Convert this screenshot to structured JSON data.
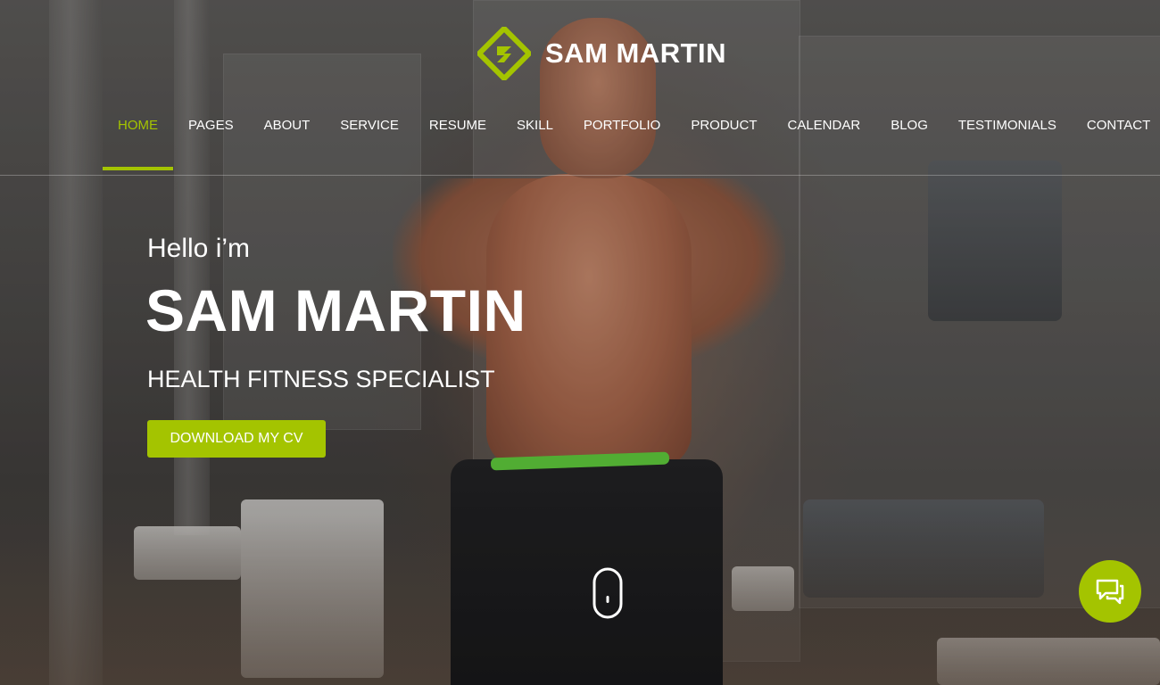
{
  "brand": {
    "name": "SAM MARTIN",
    "logo_icon": "diamond-s-logo-icon"
  },
  "nav": {
    "items": [
      {
        "label": "HOME",
        "active": true
      },
      {
        "label": "PAGES",
        "active": false
      },
      {
        "label": "ABOUT",
        "active": false
      },
      {
        "label": "SERVICE",
        "active": false
      },
      {
        "label": "RESUME",
        "active": false
      },
      {
        "label": "SKILL",
        "active": false
      },
      {
        "label": "PORTFOLIO",
        "active": false
      },
      {
        "label": "PRODUCT",
        "active": false
      },
      {
        "label": "CALENDAR",
        "active": false
      },
      {
        "label": "BLOG",
        "active": false
      },
      {
        "label": "TESTIMONIALS",
        "active": false
      },
      {
        "label": "CONTACT",
        "active": false
      }
    ]
  },
  "hero": {
    "greeting": "Hello i’m",
    "name": "SAM MARTIN",
    "role": "HEALTH FITNESS SPECIALIST",
    "cta_label": "DOWNLOAD MY CV"
  },
  "scroll": {
    "icon": "mouse-scroll-icon"
  },
  "chat": {
    "icon": "chat-bubbles-icon"
  },
  "colors": {
    "accent": "#a4c400",
    "text": "#ffffff"
  }
}
